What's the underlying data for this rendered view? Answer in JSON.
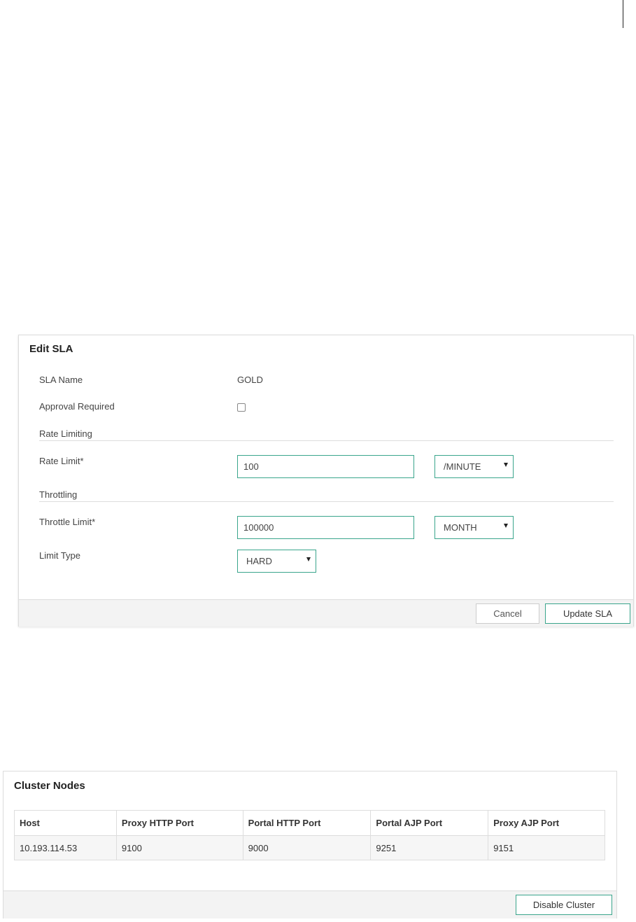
{
  "edit_sla": {
    "title": "Edit SLA",
    "sla_name_label": "SLA Name",
    "sla_name_value": "GOLD",
    "approval_label": "Approval Required",
    "approval_checked": false,
    "rate_limiting_section": "Rate Limiting",
    "rate_limit_label": "Rate Limit*",
    "rate_limit_value": "100",
    "rate_limit_unit": "/MINUTE",
    "throttling_section": "Throttling",
    "throttle_limit_label": "Throttle Limit*",
    "throttle_limit_value": "100000",
    "throttle_limit_unit": "MONTH",
    "limit_type_label": "Limit Type",
    "limit_type_value": "HARD",
    "cancel_label": "Cancel",
    "update_label": "Update SLA"
  },
  "cluster_nodes": {
    "title": "Cluster Nodes",
    "columns": [
      "Host",
      "Proxy HTTP Port",
      "Portal HTTP Port",
      "Portal AJP Port",
      "Proxy AJP Port"
    ],
    "rows": [
      [
        "10.193.114.53",
        "9100",
        "9000",
        "9251",
        "9151"
      ]
    ],
    "disable_label": "Disable Cluster"
  },
  "colors": {
    "accent": "#3aa58c",
    "footer_bg": "#f3f3f3",
    "row_bg": "#f6f6f6"
  }
}
